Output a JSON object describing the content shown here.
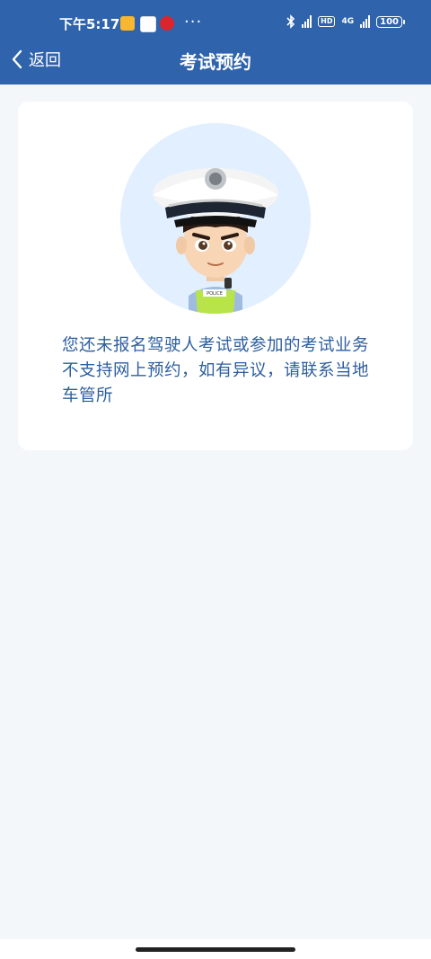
{
  "status_bar": {
    "time": "下午5:17",
    "dots": "···",
    "network_type": "4G",
    "hd_label": "HD",
    "battery": "100"
  },
  "navbar": {
    "back_label": "返回",
    "title": "考试预约"
  },
  "card": {
    "message": "您还未报名驾驶人考试或参加的考试业务不支持网上预约，如有异议，请联系当地车管所",
    "avatar_badge": "POLICE"
  },
  "colors": {
    "header_bg": "#2f63ac",
    "message_text": "#2d5f9f",
    "page_bg": "#f4f7f9",
    "avatar_bg": "#e1efff"
  }
}
